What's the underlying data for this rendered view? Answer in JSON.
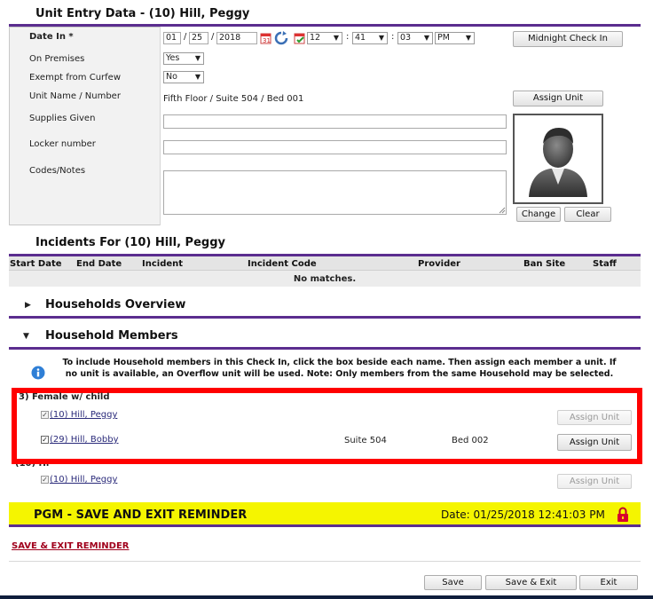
{
  "unit_entry": {
    "title": "Unit Entry Data - (10) Hill, Peggy",
    "date_in_label": "Date In *",
    "date_month": "01",
    "date_day": "25",
    "date_year": "2018",
    "date_sep": "/",
    "hour": "12",
    "minute": "41",
    "second": "03",
    "ampm": "PM",
    "time_sep": ":",
    "midnight_button": "Midnight Check In",
    "on_premises_label": "On Premises",
    "on_premises_value": "Yes",
    "exempt_label": "Exempt from Curfew",
    "exempt_value": "No",
    "unit_label": "Unit Name / Number",
    "unit_value": "Fifth Floor / Suite 504 / Bed 001",
    "assign_unit_button": "Assign Unit",
    "supplies_label": "Supplies Given",
    "supplies_value": "",
    "locker_label": "Locker number",
    "locker_value": "",
    "codes_label": "Codes/Notes",
    "codes_value": "",
    "change_button": "Change",
    "clear_button": "Clear"
  },
  "incidents": {
    "title": "Incidents For (10) Hill, Peggy",
    "columns": [
      "Start Date",
      "End Date",
      "Incident",
      "Incident Code",
      "Provider",
      "Ban Site",
      "Staff"
    ],
    "empty_text": "No matches."
  },
  "households_overview": {
    "title": "Households Overview"
  },
  "household_members": {
    "title": "Household Members",
    "info_text": "To include Household members in this Check In, click the box beside each name. Then assign each member a unit. If no unit is available, an Overflow unit will be used. Note: Only members from the same Household may be selected.",
    "group_label": "3) Female w/ child",
    "members": [
      {
        "name": "(10) Hill, Peggy",
        "unit": "",
        "bed": "",
        "button": "Assign Unit"
      },
      {
        "name": "(29) Hill, Bobby",
        "unit": "Suite 504",
        "bed": "Bed 002",
        "button": "Assign Unit"
      }
    ],
    "group2_label": "(10) Hi",
    "group2_member": {
      "name": "(10) Hill, Peggy",
      "button": "Assign Unit"
    }
  },
  "reminder": {
    "title": "PGM - SAVE AND EXIT REMINDER",
    "date": "Date: 01/25/2018 12:41:03 PM",
    "link": "SAVE & EXIT REMINDER"
  },
  "footer": {
    "save": "Save",
    "save_exit": "Save & Exit",
    "exit": "Exit"
  },
  "colors": {
    "accent_purple": "#5b2d8f",
    "highlight_red": "#ff0000",
    "reminder_yellow": "#f5f500"
  }
}
